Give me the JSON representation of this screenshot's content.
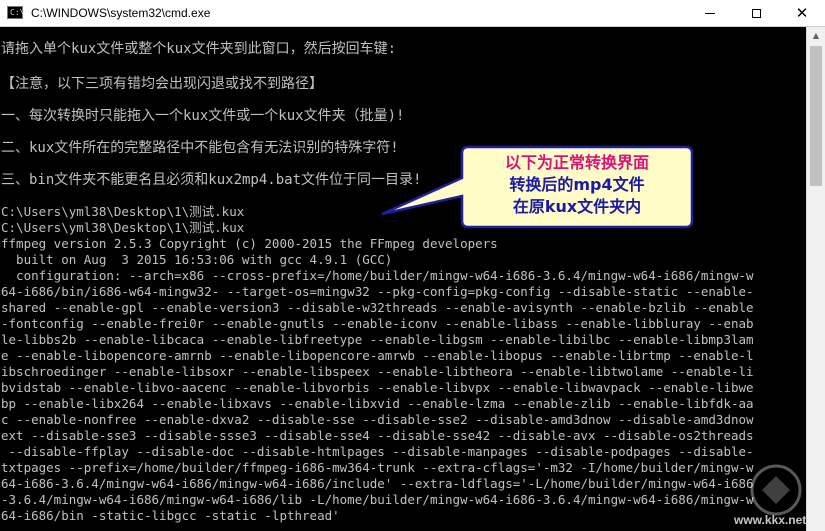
{
  "window": {
    "title": "C:\\WINDOWS\\system32\\cmd.exe",
    "icon": "cmd-icon",
    "buttons": {
      "minimize": "minimize-icon",
      "maximize": "maximize-icon",
      "close": "close-icon"
    }
  },
  "console": {
    "lines": [
      "请拖入单个kux文件或整个kux文件夹到此窗口，然后按回车键:",
      "【注意，以下三项有错均会出现闪退或找不到路径】",
      "一、每次转换时只能拖入一个kux文件或一个kux文件夹（批量)!",
      "二、kux文件所在的完整路径中不能包含有无法识别的特殊字符!",
      "三、bin文件夹不能更名且必须和kux2mp4.bat文件位于同一目录!",
      "C:\\Users\\yml38\\Desktop\\1\\测试.kux",
      "C:\\Users\\yml38\\Desktop\\1\\测试.kux",
      "ffmpeg version 2.5.3 Copyright (c) 2000-2015 the FFmpeg developers",
      "  built on Aug  3 2015 16:53:06 with gcc 4.9.1 (GCC)",
      "  configuration: --arch=x86 --cross-prefix=/home/builder/mingw-w64-i686-3.6.4/mingw-w64-i686/mingw-w",
      "64-i686/bin/i686-w64-mingw32- --target-os=mingw32 --pkg-config=pkg-config --disable-static --enable-",
      "shared --enable-gpl --enable-version3 --disable-w32threads --enable-avisynth --enable-bzlib --enable",
      "-fontconfig --enable-frei0r --enable-gnutls --enable-iconv --enable-libass --enable-libbluray --enab",
      "le-libbs2b --enable-libcaca --enable-libfreetype --enable-libgsm --enable-libilbc --enable-libmp3lam",
      "e --enable-libopencore-amrnb --enable-libopencore-amrwb --enable-libopus --enable-librtmp --enable-l",
      "ibschroedinger --enable-libsoxr --enable-libspeex --enable-libtheora --enable-libtwolame --enable-li",
      "bvidstab --enable-libvo-aacenc --enable-libvorbis --enable-libvpx --enable-libwavpack --enable-libwe",
      "bp --enable-libx264 --enable-libxavs --enable-libxvid --enable-lzma --enable-zlib --enable-libfdk-aa",
      "c --enable-nonfree --enable-dxva2 --disable-sse --disable-sse2 --disable-amd3dnow --disable-amd3dnow",
      "ext --disable-sse3 --disable-ssse3 --disable-sse4 --disable-sse42 --disable-avx --disable-os2threads",
      " --disable-ffplay --disable-doc --disable-htmlpages --disable-manpages --disable-podpages --disable-",
      "txtpages --prefix=/home/builder/ffmpeg-i686-mw364-trunk --extra-cflags='-m32 -I/home/builder/mingw-w",
      "64-i686-3.6.4/mingw-w64-i686/mingw-w64-i686/include' --extra-ldflags='-L/home/builder/mingw-w64-i686",
      "-3.6.4/mingw-w64-i686/mingw-w64-i686/lib -L/home/builder/mingw-w64-i686-3.6.4/mingw-w64-i686/mingw-w",
      "64-i686/bin -static-libgcc -static -lpthread'"
    ]
  },
  "callout": {
    "line1": "以下为正常转换界面",
    "line2": "转换后的mp4文件",
    "line3": "在原kux文件夹内",
    "colors": {
      "fill": "#fffcc8",
      "border": "#1f1fa0",
      "line1": "#d6157a",
      "line2": "#1a1aa6"
    }
  },
  "watermark": {
    "text": "www.kkx.net"
  }
}
